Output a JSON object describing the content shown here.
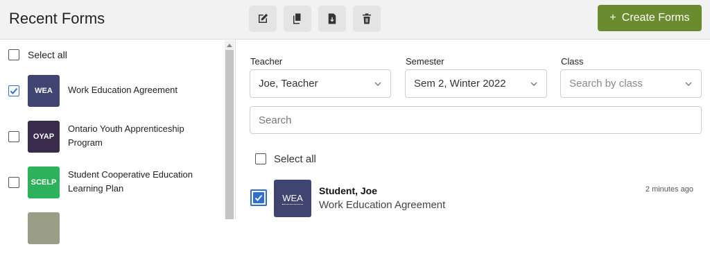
{
  "header": {
    "title": "Recent Forms",
    "tools": [
      {
        "name": "edit-icon"
      },
      {
        "name": "copy-icon"
      },
      {
        "name": "download-icon"
      },
      {
        "name": "trash-icon"
      }
    ],
    "create_button": {
      "icon": "+",
      "label": "Create Forms",
      "color": "#6b8c2e"
    }
  },
  "left_panel": {
    "select_all_label": "Select all",
    "forms": [
      {
        "abbr": "WEA",
        "name": "Work Education Agreement",
        "checked": true,
        "color": "#3f4470"
      },
      {
        "abbr": "OYAP",
        "name": "Ontario Youth Apprenticeship Program",
        "checked": false,
        "color": "#3a2a4c"
      },
      {
        "abbr": "SCELP",
        "name": "Student Cooperative Education Learning Plan",
        "checked": false,
        "color": "#2eb15b"
      },
      {
        "abbr": "",
        "name": "",
        "checked": false,
        "color": "#9b9e86"
      }
    ]
  },
  "filters": {
    "teacher": {
      "label": "Teacher",
      "value": "Joe, Teacher"
    },
    "semester": {
      "label": "Semester",
      "value": "Sem 2, Winter 2022"
    },
    "class": {
      "label": "Class",
      "placeholder": "Search by class"
    },
    "search": {
      "placeholder": "Search"
    }
  },
  "results": {
    "select_all_label": "Select all",
    "items": [
      {
        "abbr": "WEA",
        "student": "Student, Joe",
        "form": "Work Education Agreement",
        "time": "2 minutes ago",
        "checked": true
      }
    ]
  }
}
